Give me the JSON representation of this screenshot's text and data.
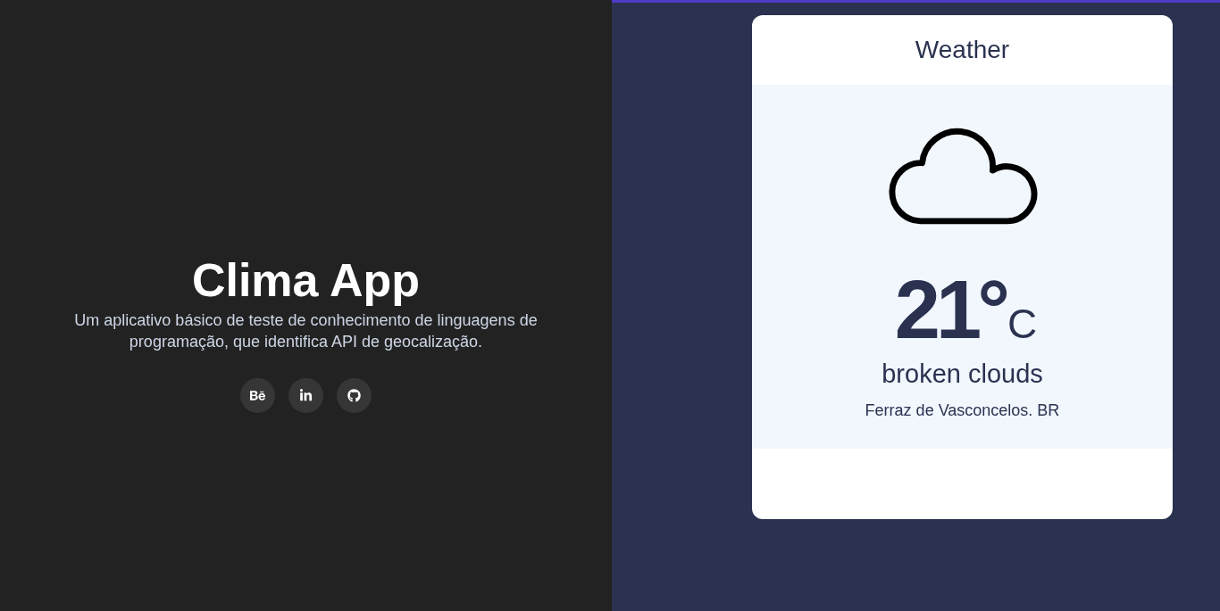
{
  "intro": {
    "title": "Clima App",
    "description": "Um aplicativo básico de teste de conhecimento de linguagens de programação, que identifica API de geocalização.",
    "social_links": [
      {
        "kind": "behance"
      },
      {
        "kind": "linkedin"
      },
      {
        "kind": "github"
      }
    ]
  },
  "weather_card": {
    "title": "Weather",
    "temperature": "21°",
    "unit": "C",
    "condition": "broken clouds",
    "location": "Ferraz de Vasconcelos. BR"
  }
}
